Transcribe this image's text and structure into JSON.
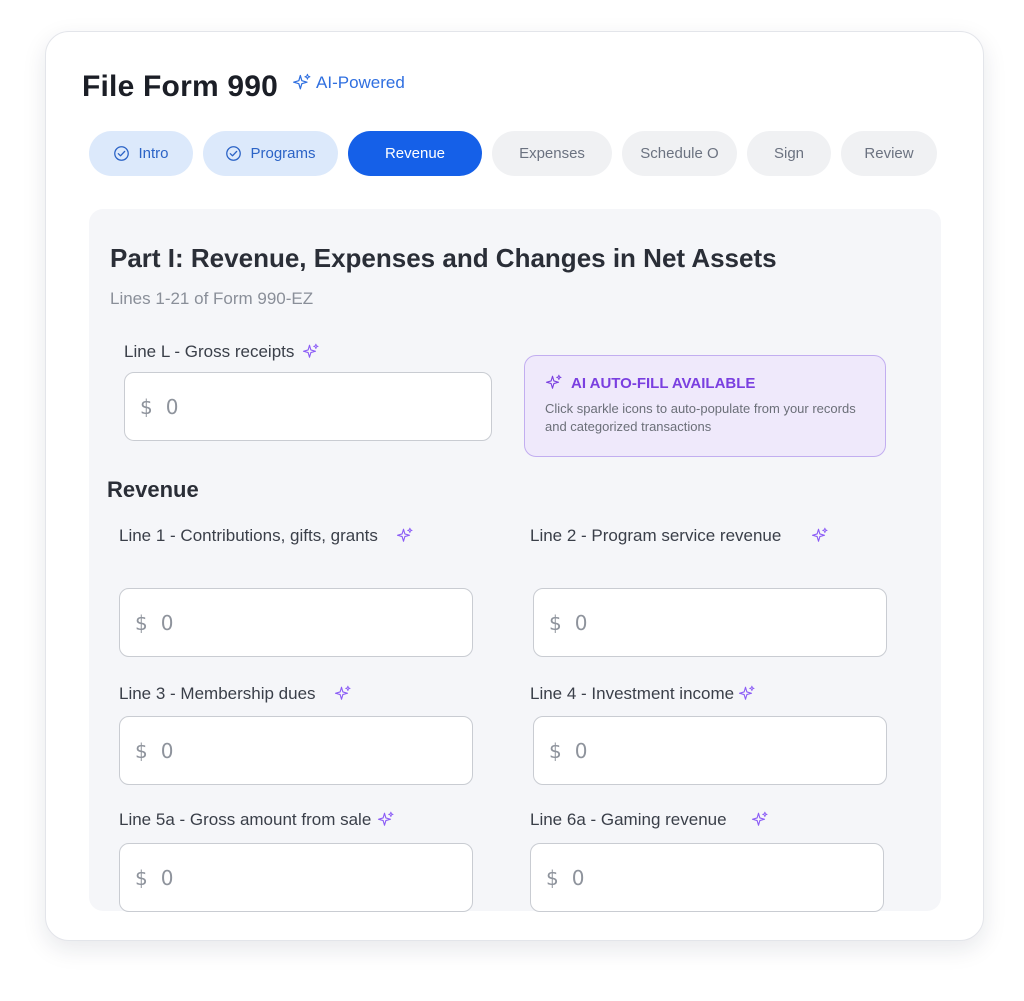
{
  "header": {
    "title": "File Form 990",
    "ai_badge": "AI-Powered"
  },
  "tabs": [
    {
      "label": "Intro",
      "state": "done"
    },
    {
      "label": "Programs",
      "state": "done"
    },
    {
      "label": "Revenue",
      "state": "active"
    },
    {
      "label": "Expenses",
      "state": "pending"
    },
    {
      "label": "Schedule O",
      "state": "pending"
    },
    {
      "label": "Sign",
      "state": "pending"
    },
    {
      "label": "Review",
      "state": "pending"
    }
  ],
  "part": {
    "title": "Part I: Revenue, Expenses and Changes in Net Assets",
    "subtitle": "Lines 1-21 of Form 990-EZ"
  },
  "gross_receipts": {
    "label": "Line L - Gross receipts",
    "currency": "$",
    "value": "0"
  },
  "autofill": {
    "title": "AI AUTO-FILL AVAILABLE",
    "body": "Click sparkle icons to auto-populate from your records and categorized transactions"
  },
  "revenue": {
    "title": "Revenue",
    "fields": [
      {
        "label": "Line 1 - Contributions, gifts, grants",
        "currency": "$",
        "value": "0"
      },
      {
        "label": "Line 2 - Program service revenue",
        "currency": "$",
        "value": "0"
      },
      {
        "label": "Line 3 - Membership dues",
        "currency": "$",
        "value": "0"
      },
      {
        "label": "Line 4 - Investment income",
        "currency": "$",
        "value": "0"
      },
      {
        "label": "Line 5a - Gross amount from sale",
        "currency": "$",
        "value": "0"
      },
      {
        "label": "Line 6a - Gaming revenue",
        "currency": "$",
        "value": "0"
      }
    ]
  },
  "colors": {
    "accent": "#1560e8",
    "ai_purple": "#7a3fe0",
    "done_tab_bg": "#dce9fb"
  },
  "icons": {
    "sparkle": "sparkle-icon",
    "check": "check-circle-icon"
  }
}
